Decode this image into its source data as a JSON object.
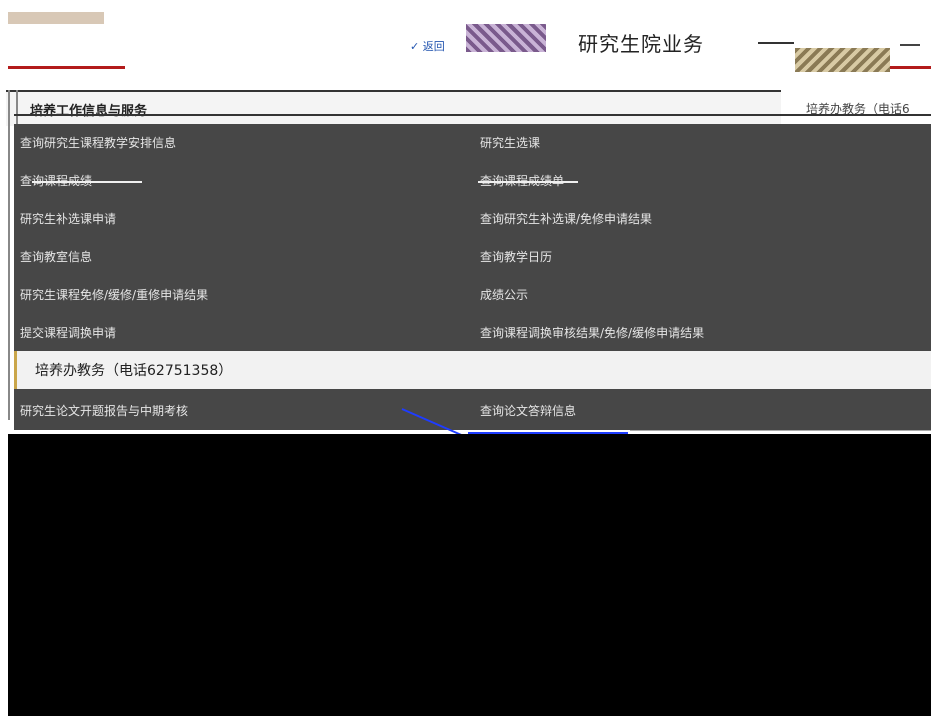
{
  "header": {
    "back_link": "✓ 返回",
    "title": "研究生院业务"
  },
  "panel": {
    "title": "培养工作信息与服务",
    "side_title": "培养办教务（电话6"
  },
  "rows": [
    {
      "left": "查询研究生课程教学安排信息",
      "right": "研究生选课"
    },
    {
      "left": "查询课程成绩",
      "right": "查询课程成绩单"
    },
    {
      "left": "研究生补选课申请",
      "right": "查询研究生补选课/免修申请结果"
    },
    {
      "left": "查询教室信息",
      "right": "查询教学日历"
    },
    {
      "left": "研究生课程免修/缓修/重修申请结果",
      "right": "成绩公示"
    },
    {
      "left": "提交课程调换申请",
      "right": "查询课程调换审核结果/免修/缓修申请结果"
    },
    {
      "left": "培养办教务（电话62751358）",
      "right": ""
    },
    {
      "left": "研究生论文开题报告与中期考核",
      "right": "查询论文答辩信息"
    }
  ],
  "colors": {
    "list_bg": "#474747",
    "highlight_bg": "#f2f2f2",
    "accent_red": "#b31b1b",
    "annotation_blue": "#1e3cff"
  }
}
